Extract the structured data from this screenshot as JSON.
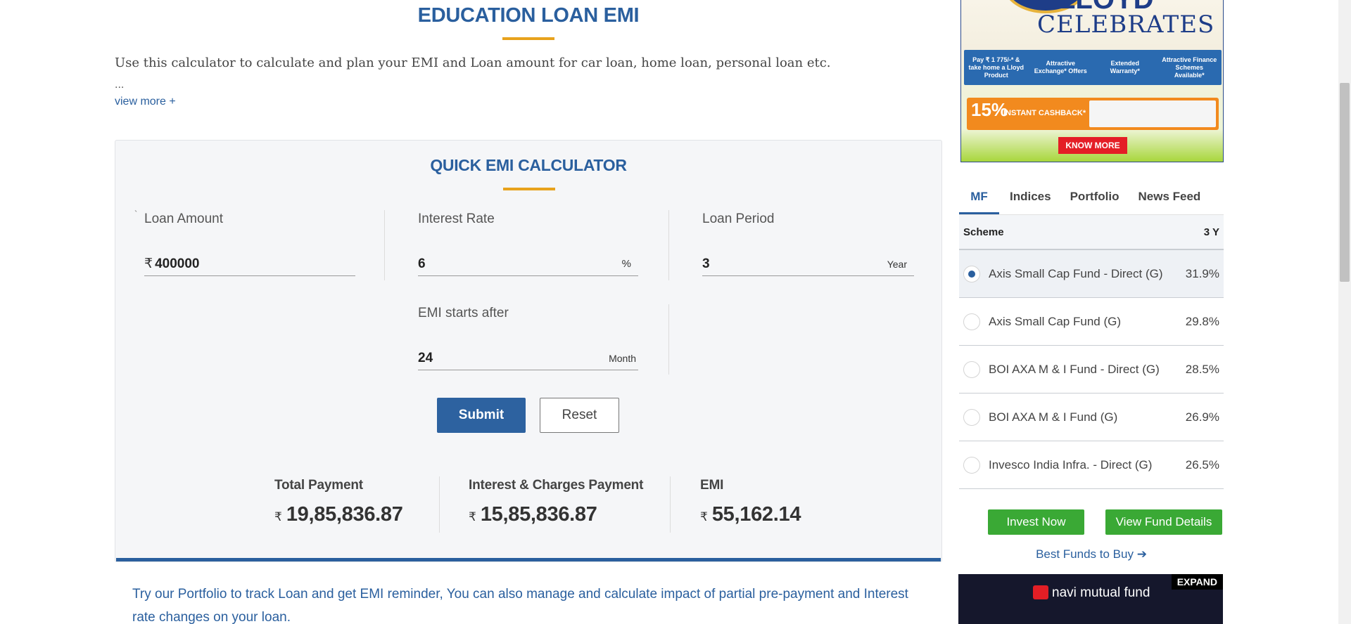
{
  "page_title": "EDUCATION LOAN EMI",
  "intro": "Use this calculator to calculate and plan your EMI and Loan amount for car loan, home loan, personal loan etc.",
  "ellipsis": "...",
  "view_more": "view more +",
  "calculator": {
    "title": "QUICK EMI CALCULATOR",
    "tick_mark": "`",
    "loan_amount": {
      "label": "Loan Amount",
      "prefix": "₹",
      "value": "400000"
    },
    "interest_rate": {
      "label": "Interest Rate",
      "value": "6",
      "suffix": "%"
    },
    "loan_period": {
      "label": "Loan Period",
      "value": "3",
      "suffix": "Year"
    },
    "emi_starts": {
      "label": "EMI starts after",
      "value": "24",
      "suffix": "Month"
    },
    "submit_label": "Submit",
    "reset_label": "Reset",
    "currency": "₹",
    "results": {
      "total_payment": {
        "label": "Total Payment",
        "value": "19,85,836.87"
      },
      "interest_payment": {
        "label": "Interest & Charges Payment",
        "value": "15,85,836.87"
      },
      "emi": {
        "label": "EMI",
        "value": "55,162.14"
      }
    }
  },
  "portfolio_note": "Try our Portfolio to track Loan and get EMI reminder, You can also manage and calculate impact of partial pre-payment and Interest rate changes on your loan.",
  "ad_top": {
    "brand": "LLOYD",
    "headline": "CELEBRATES",
    "badges": [
      "Pay ₹ 1 775/-* & take home a Lloyd Product",
      "Attractive Exchange* Offers",
      "Extended Warranty*",
      "Attractive Finance Schemes Available*"
    ],
    "cashback_pct": "15%",
    "cashback_text": "INSTANT CASHBACK*",
    "cta": "KNOW MORE"
  },
  "sidebar": {
    "tabs": [
      "MF",
      "Indices",
      "Portfolio",
      "News Feed"
    ],
    "table_header": {
      "scheme": "Scheme",
      "period": "3 Y"
    },
    "funds": [
      {
        "name": "Axis Small Cap Fund - Direct (G)",
        "return": "31.9%",
        "selected": true
      },
      {
        "name": "Axis Small Cap Fund (G)",
        "return": "29.8%",
        "selected": false
      },
      {
        "name": "BOI AXA M & I Fund - Direct (G)",
        "return": "28.5%",
        "selected": false
      },
      {
        "name": "BOI AXA M & I Fund (G)",
        "return": "26.9%",
        "selected": false
      },
      {
        "name": "Invesco India Infra. - Direct (G)",
        "return": "26.5%",
        "selected": false
      }
    ],
    "invest_now": "Invest Now",
    "view_fund_details": "View Fund Details",
    "best_funds": "Best Funds to Buy ➔"
  },
  "ad_bottom": {
    "expand": "EXPAND",
    "brand_text": "navi mutual fund"
  },
  "colors": {
    "brand_blue": "#2a5f9e",
    "accent_orange": "#e8a21c",
    "green_button": "#3aa935"
  }
}
